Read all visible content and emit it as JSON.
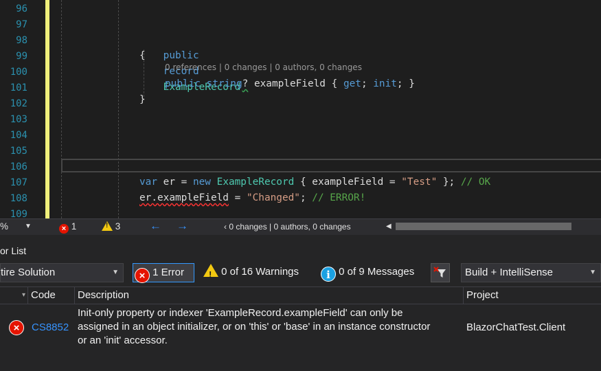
{
  "editor": {
    "line_numbers": [
      "96",
      "97",
      "98",
      "99",
      "100",
      "101",
      "102",
      "103",
      "104",
      "105",
      "106",
      "107",
      "108",
      "109"
    ],
    "code_lens": "0 references | 0 changes | 0 authors, 0 changes",
    "lines": {
      "l98": {
        "kw1": "public",
        "kw2": "record",
        "type": "ExampleRecord"
      },
      "l99": {
        "brace": "{"
      },
      "l101": {
        "kw1": "public",
        "kw2": "string",
        "q": "?",
        "name": " exampleField ",
        "rest1": "{ ",
        "get": "get",
        "semi1": "; ",
        "init": "init",
        "rest2": "; }"
      },
      "l102": {
        "brace": "}"
      },
      "l107": {
        "kw_var": "var",
        "er": " er = ",
        "kw_new": "new",
        "type": "ExampleRecord",
        "mid": " { exampleField = ",
        "str": "\"Test\"",
        "end": " }; ",
        "comment": "// OK"
      },
      "l108": {
        "target": "er.exampleField",
        "eq": " = ",
        "str": "\"Changed\"",
        "semi": "; ",
        "comment": "// ERROR!"
      }
    }
  },
  "strip": {
    "zoom": "%",
    "errors": "1",
    "warnings": "3",
    "codelens": "0 changes | 0 authors, 0 changes"
  },
  "error_list": {
    "title": "or List",
    "scope": "tire Solution",
    "errors_label": "1 Error",
    "warnings_label": "0 of 16 Warnings",
    "messages_label": "0 of 9 Messages",
    "build_filter": "Build + IntelliSense",
    "columns": {
      "code": "Code",
      "description": "Description",
      "project": "Project"
    },
    "rows": [
      {
        "code": "CS8852",
        "description_lines": [
          "Init-only property or indexer 'ExampleRecord.exampleField' can only be",
          "assigned in an object initializer, or on 'this' or 'base' in an instance constructor",
          "or an 'init' accessor."
        ],
        "project": "BlazorChatTest.Client"
      }
    ]
  },
  "colors": {
    "error": "#e51400",
    "warning": "#f2c811",
    "info": "#1ba1e2",
    "link": "#3794ff",
    "change_bar": "#efef7b"
  }
}
